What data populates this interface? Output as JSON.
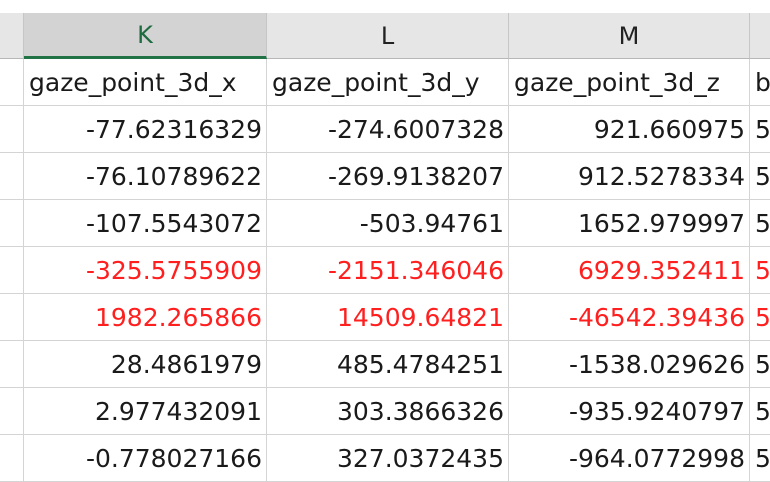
{
  "columns": [
    {
      "letter": "K",
      "selected": true
    },
    {
      "letter": "L",
      "selected": false
    },
    {
      "letter": "M",
      "selected": false
    }
  ],
  "header_row": [
    "gaze_point_3d_x",
    "gaze_point_3d_y",
    "gaze_point_3d_z",
    "b"
  ],
  "rows": [
    {
      "values": [
        "-77.62316329",
        "-274.6007328",
        "921.660975",
        "5"
      ],
      "highlight": false
    },
    {
      "values": [
        "-76.10789622",
        "-269.9138207",
        "912.5278334",
        "5"
      ],
      "highlight": false
    },
    {
      "values": [
        "-107.5543072",
        "-503.94761",
        "1652.979997",
        "5"
      ],
      "highlight": false
    },
    {
      "values": [
        "-325.5755909",
        "-2151.346046",
        "6929.352411",
        "5"
      ],
      "highlight": true
    },
    {
      "values": [
        "1982.265866",
        "14509.64821",
        "-46542.39436",
        "5"
      ],
      "highlight": true
    },
    {
      "values": [
        "28.4861979",
        "485.4784251",
        "-1538.029626",
        "5"
      ],
      "highlight": false
    },
    {
      "values": [
        "2.977432091",
        "303.3866326",
        "-935.9240797",
        "5"
      ],
      "highlight": false
    },
    {
      "values": [
        "-0.778027166",
        "327.0372435",
        "-964.0772998",
        "5"
      ],
      "highlight": false
    }
  ],
  "colors": {
    "highlight_text": "#ff1f1f",
    "selected_header_text": "#1e6b3f",
    "selected_header_underline": "#217346"
  }
}
